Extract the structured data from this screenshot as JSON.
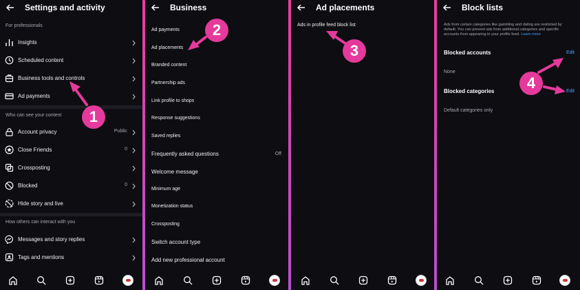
{
  "colors": {
    "accent": "#e53a9b",
    "link": "#4aa3ff",
    "background": "#0d0d12"
  },
  "panel1": {
    "title": "Settings and activity",
    "section_professionals": "For professionals",
    "items_pro": [
      {
        "label": "Insights",
        "icon": "bar-chart-icon"
      },
      {
        "label": "Scheduled content",
        "icon": "clock-icon"
      },
      {
        "label": "Business tools and controls",
        "icon": "briefcase-icon"
      },
      {
        "label": "Ad payments",
        "icon": "card-icon"
      }
    ],
    "section_content": "Who can see your content",
    "items_content": [
      {
        "label": "Account privacy",
        "value": "Public",
        "icon": "lock-icon"
      },
      {
        "label": "Close Friends",
        "value": "0",
        "icon": "star-icon"
      },
      {
        "label": "Crossposting",
        "value": "",
        "icon": "crosspost-icon"
      },
      {
        "label": "Blocked",
        "value": "0",
        "icon": "blocked-icon"
      },
      {
        "label": "Hide story and live",
        "value": "",
        "icon": "hide-story-icon"
      }
    ],
    "section_interact": "How others can interact with you",
    "items_interact": [
      {
        "label": "Messages and story replies",
        "icon": "messenger-icon"
      },
      {
        "label": "Tags and mentions",
        "icon": "tag-icon"
      }
    ],
    "badge": "1"
  },
  "panel2": {
    "title": "Business",
    "items": [
      {
        "label": "Ad payments",
        "value": ""
      },
      {
        "label": "Ad placements",
        "value": ""
      },
      {
        "label": "Branded content",
        "value": ""
      },
      {
        "label": "Partnership ads",
        "value": ""
      },
      {
        "label": "Link profile to shops",
        "value": ""
      },
      {
        "label": "Response suggestions",
        "value": ""
      },
      {
        "label": "Saved replies",
        "value": ""
      },
      {
        "label": "Frequently asked questions",
        "value": "Off"
      },
      {
        "label": "Welcome message",
        "value": ""
      },
      {
        "label": "Minimum age",
        "value": ""
      },
      {
        "label": "Monetization status",
        "value": ""
      },
      {
        "label": "Crossposting",
        "value": ""
      },
      {
        "label": "Switch account type",
        "value": ""
      },
      {
        "label": "Add new professional account",
        "value": ""
      }
    ],
    "badge": "2"
  },
  "panel3": {
    "title": "Ad placements",
    "item": "Ads in profile feed block list",
    "badge": "3"
  },
  "panel4": {
    "title": "Block lists",
    "description": "Ads from certain categories like gambling and dating are restricted by default. You can prevent ads from additional categories and specific accounts from appearing in your profile feed.",
    "learn_more": "Learn more",
    "blocked_accounts": "Blocked accounts",
    "blocked_accounts_value": "None",
    "blocked_categories": "Blocked categories",
    "blocked_categories_value": "Default categories only",
    "edit_label": "Edit",
    "badge": "4"
  },
  "navbar": {
    "icons": [
      "home-icon",
      "search-icon",
      "create-icon",
      "reels-icon",
      "profile-avatar"
    ]
  }
}
